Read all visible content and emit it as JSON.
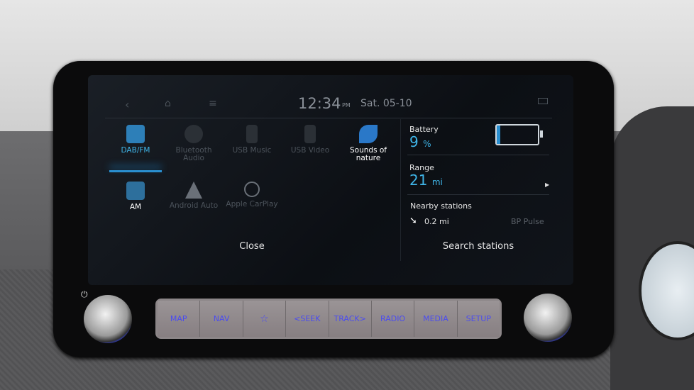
{
  "status_bar": {
    "time": "12:34",
    "ampm": "PM",
    "date": "Sat. 05-10"
  },
  "media_sources": [
    {
      "label": "DAB/FM",
      "state": "selected"
    },
    {
      "label": "Bluetooth Audio",
      "state": "disabled"
    },
    {
      "label": "USB Music",
      "state": "disabled"
    },
    {
      "label": "USB Video",
      "state": "disabled"
    },
    {
      "label": "Sounds of nature",
      "state": "enabled"
    },
    {
      "label": "AM",
      "state": "enabled"
    },
    {
      "label": "Android Auto",
      "state": "disabled"
    },
    {
      "label": "Apple CarPlay",
      "state": "disabled"
    }
  ],
  "close_label": "Close",
  "ev_panel": {
    "battery_label": "Battery",
    "battery_value": "9",
    "battery_unit": "%",
    "battery_level": 0.09,
    "range_label": "Range",
    "range_value": "21",
    "range_unit": "mi",
    "nearby_label": "Nearby stations",
    "nearby_distance": "0.2 mi",
    "nearby_name": "BP Pulse",
    "search_label": "Search stations"
  },
  "hard_buttons": [
    "MAP",
    "NAV",
    "☆",
    "<SEEK",
    "TRACK>",
    "RADIO",
    "MEDIA",
    "SETUP"
  ],
  "colors": {
    "accent": "#3fb5e8",
    "button_text": "#4b4cf0"
  }
}
